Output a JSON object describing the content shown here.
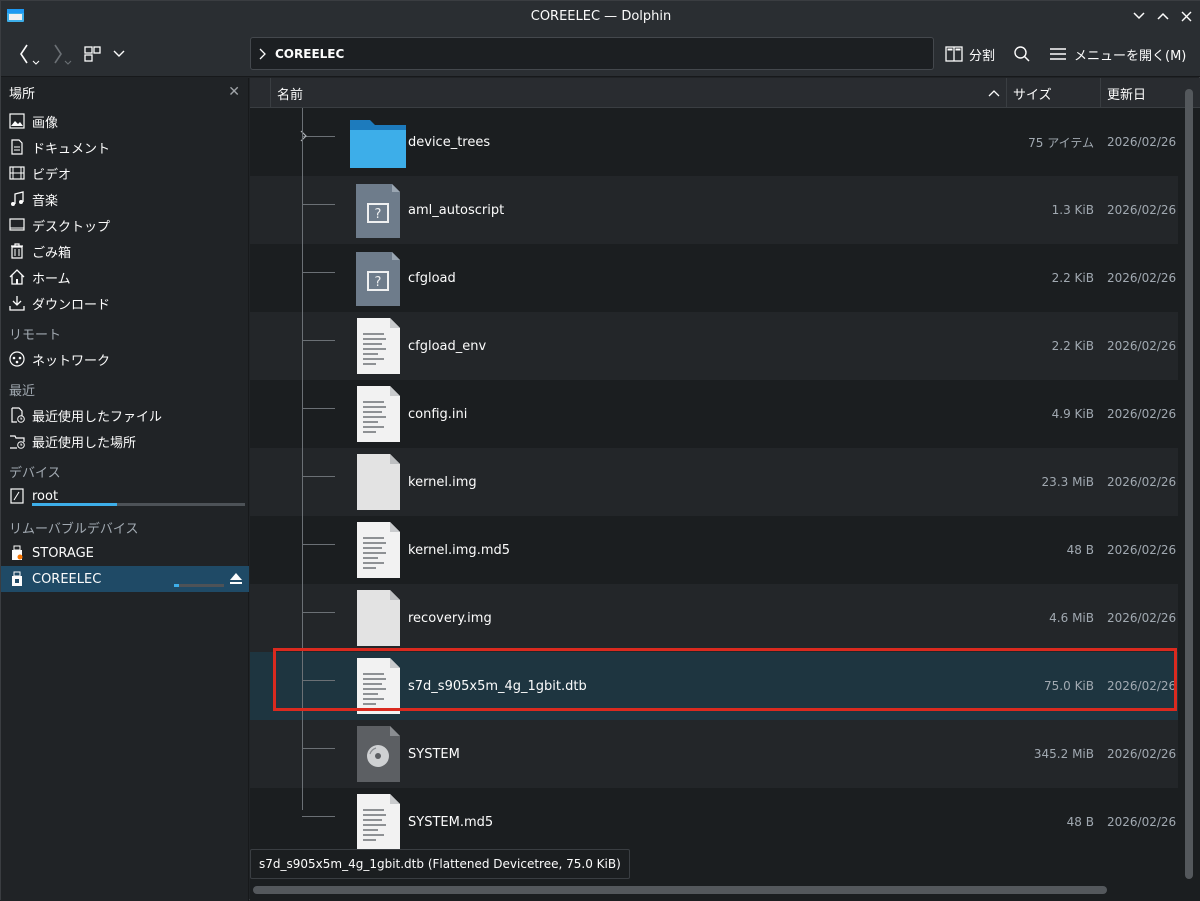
{
  "window": {
    "title": "COREELEC — Dolphin"
  },
  "toolbar": {
    "split_label": "分割",
    "menu_label": "メニューを開く(M)"
  },
  "breadcrumb": {
    "current": "COREELEC"
  },
  "sidebar": {
    "header": "場所",
    "places": [
      {
        "label": "画像",
        "icon": "image-icon"
      },
      {
        "label": "ドキュメント",
        "icon": "document-icon"
      },
      {
        "label": "ビデオ",
        "icon": "video-icon"
      },
      {
        "label": "音楽",
        "icon": "music-icon"
      },
      {
        "label": "デスクトップ",
        "icon": "desktop-icon"
      },
      {
        "label": "ごみ箱",
        "icon": "trash-icon"
      },
      {
        "label": "ホーム",
        "icon": "home-icon"
      },
      {
        "label": "ダウンロード",
        "icon": "download-icon"
      }
    ],
    "remote_header": "リモート",
    "remote": [
      {
        "label": "ネットワーク",
        "icon": "network-icon"
      }
    ],
    "recent_header": "最近",
    "recent": [
      {
        "label": "最近使用したファイル",
        "icon": "recent-files-icon"
      },
      {
        "label": "最近使用した場所",
        "icon": "recent-locations-icon"
      }
    ],
    "devices_header": "デバイス",
    "devices": [
      {
        "label": "root",
        "icon": "drive-icon",
        "usage": 0.4
      }
    ],
    "removable_header": "リムーバブルデバイス",
    "removable": [
      {
        "label": "STORAGE",
        "icon": "usb-drive-icon"
      },
      {
        "label": "COREELEC",
        "icon": "usb-drive-icon",
        "usage": 0.1
      }
    ]
  },
  "columns": {
    "name": "名前",
    "size": "サイズ",
    "modified": "更新日"
  },
  "files": [
    {
      "name": "device_trees",
      "size": "75 アイテム",
      "date": "2026/02/26",
      "kind": "folder"
    },
    {
      "name": "aml_autoscript",
      "size": "1.3 KiB",
      "date": "2026/02/26",
      "kind": "unknown"
    },
    {
      "name": "cfgload",
      "size": "2.2 KiB",
      "date": "2026/02/26",
      "kind": "unknown"
    },
    {
      "name": "cfgload_env",
      "size": "2.2 KiB",
      "date": "2026/02/26",
      "kind": "text"
    },
    {
      "name": "config.ini",
      "size": "4.9 KiB",
      "date": "2026/02/26",
      "kind": "text"
    },
    {
      "name": "kernel.img",
      "size": "23.3 MiB",
      "date": "2026/02/26",
      "kind": "blank"
    },
    {
      "name": "kernel.img.md5",
      "size": "48 B",
      "date": "2026/02/26",
      "kind": "text"
    },
    {
      "name": "recovery.img",
      "size": "4.6 MiB",
      "date": "2026/02/26",
      "kind": "blank"
    },
    {
      "name": "s7d_s905x5m_4g_1gbit.dtb",
      "size": "75.0 KiB",
      "date": "2026/02/26",
      "kind": "text"
    },
    {
      "name": "SYSTEM",
      "size": "345.2 MiB",
      "date": "2026/02/26",
      "kind": "disc"
    },
    {
      "name": "SYSTEM.md5",
      "size": "48 B",
      "date": "2026/02/26",
      "kind": "text"
    }
  ],
  "status": {
    "text": "s7d_s905x5m_4g_1gbit.dtb (Flattened Devicetree, 75.0 KiB)"
  },
  "colors": {
    "accent": "#3daee9",
    "highlight_box": "#da2a1f",
    "folder": "#3daee9"
  }
}
